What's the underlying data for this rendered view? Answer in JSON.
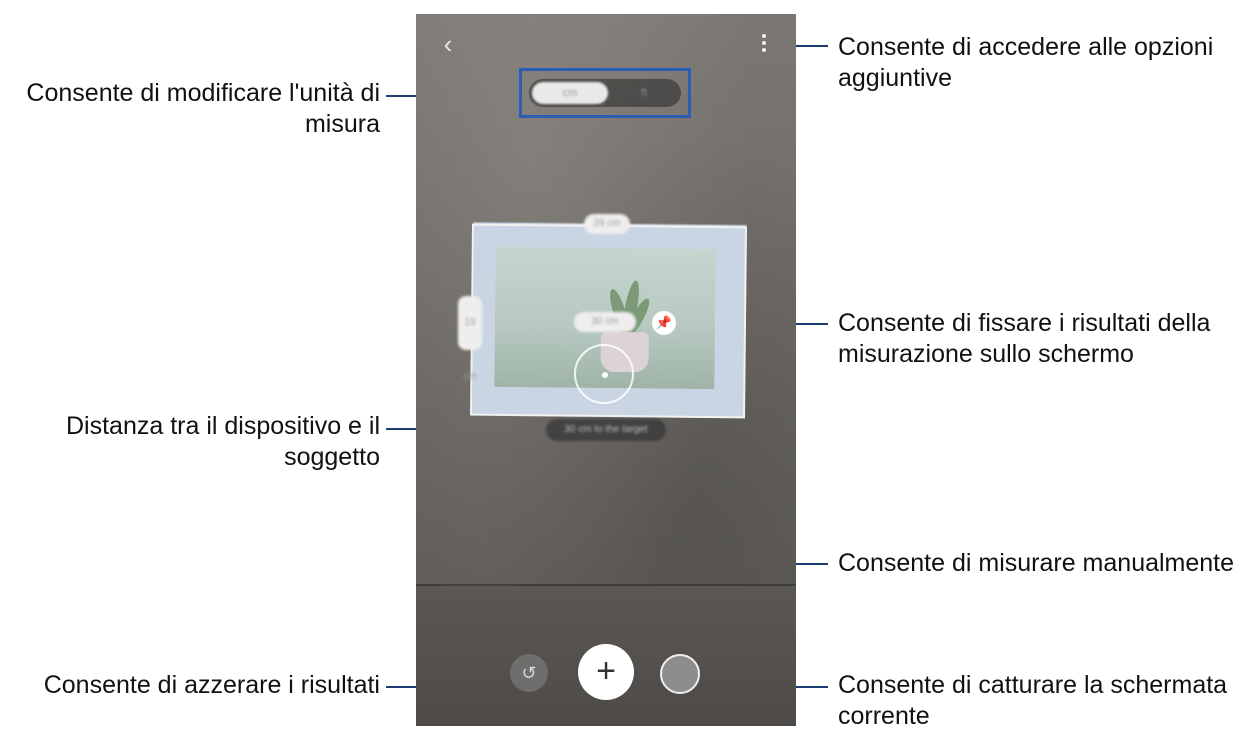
{
  "callouts": {
    "unit": "Consente di modificare l'unità di misura",
    "distance": "Distanza tra il dispositivo e il soggetto",
    "reset": "Consente di azzerare i risultati",
    "options": "Consente di accedere alle opzioni aggiuntive",
    "pin": "Consente di fissare i risultati della misurazione sullo schermo",
    "manual": "Consente di misurare manualmente",
    "capture": "Consente di catturare la schermata corrente"
  },
  "screen": {
    "back_icon": "chevron-left",
    "more_icon": "more-vertical",
    "unit_on": "cm",
    "unit_off": "ft",
    "width_label": "29 cm",
    "height_label": "19 cm",
    "pin_label": "30 cm",
    "distance_label": "30 cm to the target",
    "reset_icon": "↺",
    "add_icon": "+",
    "pin_icon": "📌",
    "accent_color": "#1a3c73"
  }
}
